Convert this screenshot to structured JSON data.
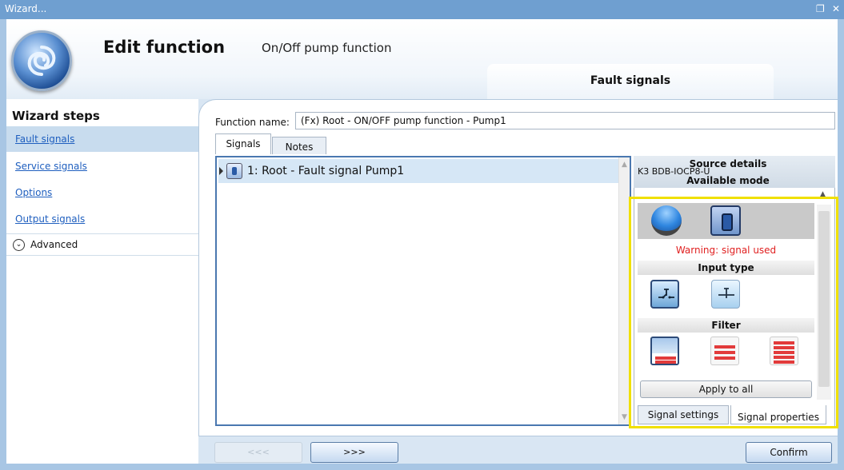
{
  "window": {
    "title": "Wizard...",
    "restore_glyph": "❐",
    "close_glyph": "✕"
  },
  "header": {
    "title": "Edit function",
    "subtitle": "On/Off pump function",
    "current_step": "Fault signals"
  },
  "nav": {
    "title": "Wizard steps",
    "items": [
      {
        "label": "Fault signals",
        "active": true
      },
      {
        "label": "Service signals",
        "active": false
      },
      {
        "label": "Options",
        "active": false
      },
      {
        "label": "Output signals",
        "active": false
      }
    ],
    "advanced_label": "Advanced",
    "advanced_icon": "chevron-down-circle-icon"
  },
  "form": {
    "function_name_label": "Function name:",
    "function_name_value": "(Fx) Root - ON/OFF pump function - Pump1"
  },
  "tabs": {
    "signals": "Signals",
    "notes": "Notes"
  },
  "signals_list": [
    {
      "label": "1: Root - Fault signal Pump1"
    }
  ],
  "source_details": {
    "title": "Source details",
    "device": "K3 BDB-IOCP8-U",
    "available_mode": "Available mode",
    "warning": "Warning: signal used",
    "input_type": "Input type",
    "filter": "Filter",
    "apply_to_all": "Apply to all",
    "tab_settings": "Signal settings",
    "tab_properties": "Signal properties"
  },
  "footer": {
    "prev": "<<<",
    "next": ">>>",
    "confirm": "Confirm"
  },
  "colors": {
    "accent": "#6f9fd0",
    "warning": "#e02020",
    "highlight": "#f0e000"
  }
}
